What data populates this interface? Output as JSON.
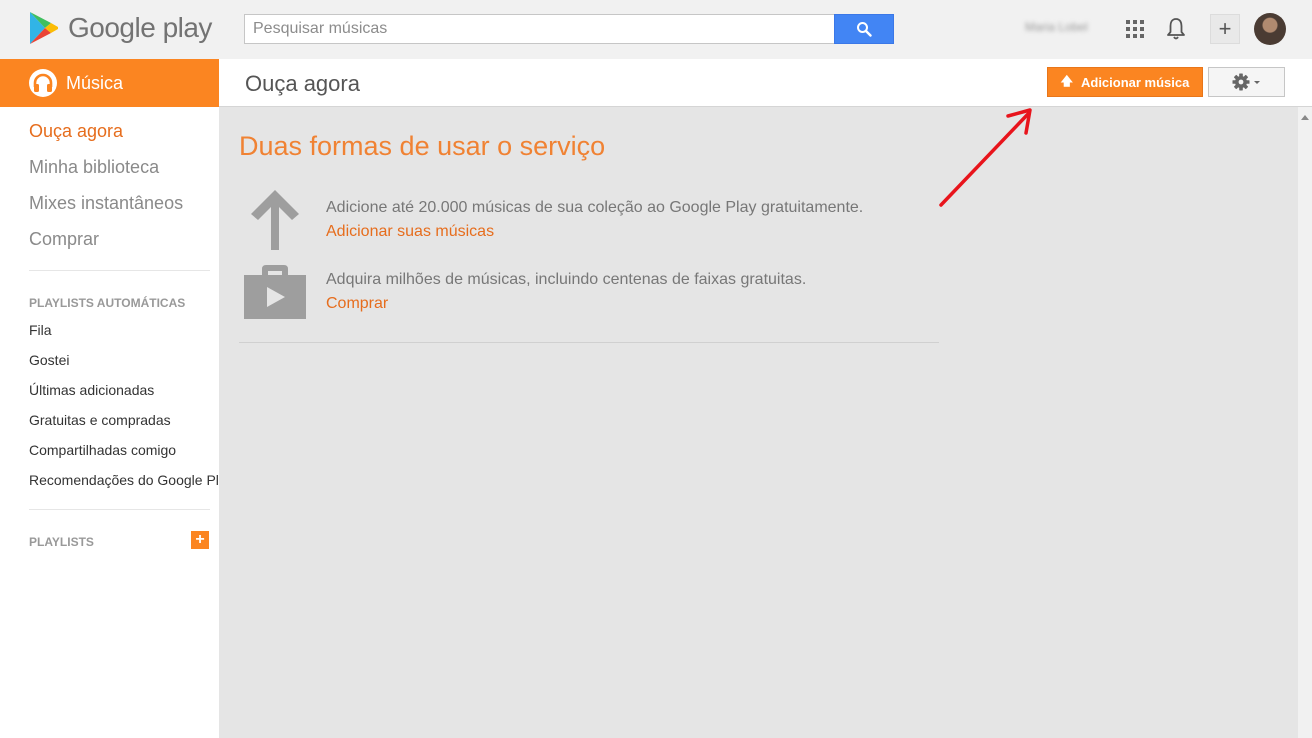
{
  "topbar": {
    "logo_text": "Google play",
    "search_placeholder": "Pesquisar músicas",
    "search_value": "",
    "user_name": "Maria Lobel"
  },
  "brand": {
    "section_label": "Música"
  },
  "header": {
    "title": "Ouça agora",
    "add_music_label": "Adicionar música"
  },
  "sidebar": {
    "nav": [
      {
        "label": "Ouça agora",
        "active": true
      },
      {
        "label": "Minha biblioteca"
      },
      {
        "label": "Mixes instantâneos"
      },
      {
        "label": "Comprar"
      }
    ],
    "auto_playlists_label": "PLAYLISTS AUTOMÁTICAS",
    "auto_playlists": [
      "Fila",
      "Gostei",
      "Últimas adicionadas",
      "Gratuitas e compradas",
      "Compartilhadas comigo",
      "Recomendações do Google Play"
    ],
    "playlists_label": "PLAYLISTS",
    "add_playlist_symbol": "+"
  },
  "main": {
    "title": "Duas formas de usar o serviço",
    "features": [
      {
        "icon": "upload-arrow-icon",
        "text": "Adicione até 20.000 músicas de sua coleção ao Google Play gratuitamente.",
        "link": "Adicionar suas músicas"
      },
      {
        "icon": "shopping-bag-icon",
        "text": "Adquira milhões de músicas, incluindo centenas de faixas gratuitas.",
        "link": "Comprar"
      }
    ]
  },
  "colors": {
    "accent_orange": "#fb8521",
    "link_orange": "#e66d1d",
    "search_blue": "#4285f4",
    "annotation_red": "#e8141c"
  }
}
